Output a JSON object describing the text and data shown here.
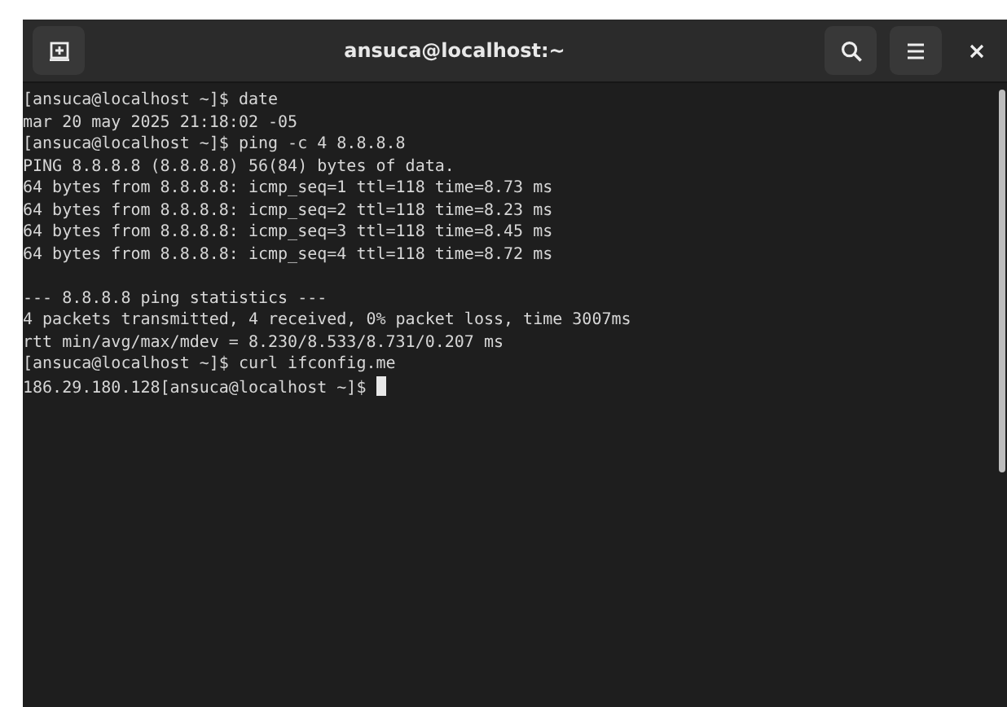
{
  "window": {
    "title": "ansuca@localhost:~"
  },
  "terminal": {
    "blocks": [
      {
        "lines": [
          "[ansuca@localhost ~]$ date",
          "mar 20 may 2025 21:18:02 -05",
          "[ansuca@localhost ~]$ ping -c 4 8.8.8.8",
          "PING 8.8.8.8 (8.8.8.8) 56(84) bytes of data.",
          "64 bytes from 8.8.8.8: icmp_seq=1 ttl=118 time=8.73 ms",
          "64 bytes from 8.8.8.8: icmp_seq=2 ttl=118 time=8.23 ms",
          "64 bytes from 8.8.8.8: icmp_seq=3 ttl=118 time=8.45 ms",
          "64 bytes from 8.8.8.8: icmp_seq=4 ttl=118 time=8.72 ms"
        ]
      },
      {
        "lines": [
          "--- 8.8.8.8 ping statistics ---",
          "4 packets transmitted, 4 received, 0% packet loss, time 3007ms",
          "rtt min/avg/max/mdev = 8.230/8.533/8.731/0.207 ms",
          "[ansuca@localhost ~]$ curl ifconfig.me",
          "186.29.180.128[ansuca@localhost ~]$ "
        ]
      }
    ]
  }
}
